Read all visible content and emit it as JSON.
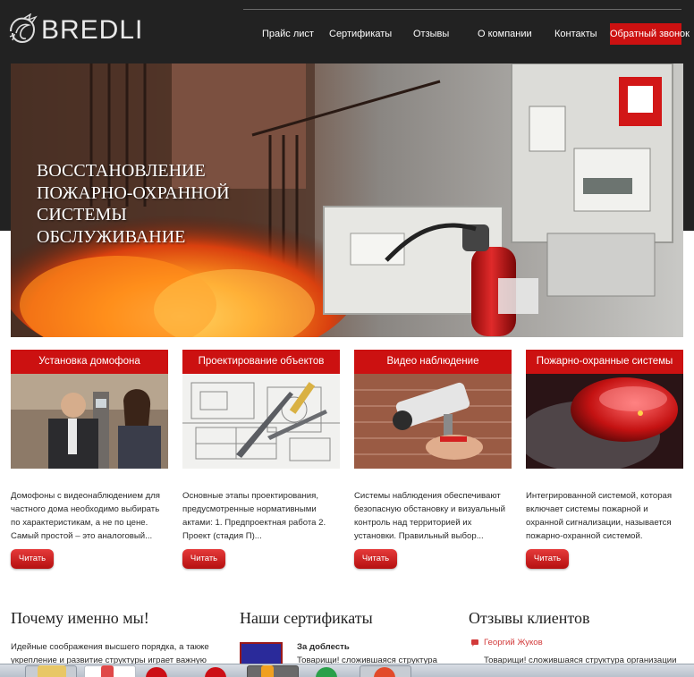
{
  "brand": {
    "name": "BREDLI",
    "text_color": "#e9e9e9",
    "accent": "#cc1111"
  },
  "nav": {
    "items": [
      {
        "label": "Прайс лист"
      },
      {
        "label": "Сертификаты"
      },
      {
        "label": "Отзывы"
      },
      {
        "label": "О компании"
      },
      {
        "label": "Контакты"
      }
    ],
    "cta": "Обратный звонок"
  },
  "hero": {
    "title_lines": [
      "Восстановление",
      "пожарно-охранной",
      "системы",
      "обслуживание"
    ],
    "image": "fire-and-alarm-equipment-photo"
  },
  "services": [
    {
      "title": "Установка домофона",
      "image": "intercom-photo",
      "text": "Домофоны с видеонаблюдением для частного дома необходимо выбирать по характеристикам, а не по цене. Самый простой – это аналоговый...",
      "button": "Читать"
    },
    {
      "title": "Проектирование объектов",
      "image": "blueprint-photo",
      "text": "Основные этапы проектирования, предусмотренные нормативными актами: 1. Предпроектная работа 2. Проект (стадия П)...",
      "button": "Читать"
    },
    {
      "title": "Видео наблюдение",
      "image": "cctv-camera-photo",
      "text": "Системы наблюдения обеспечивают безопасную обстановку и визуальный контроль над территорией их установки. Правильный выбор...",
      "button": "Читать"
    },
    {
      "title": "Пожарно-охранные системы",
      "image": "smoke-detector-photo",
      "text": "Интегрированной системой, которая включает системы пожарной и охранной сигнализации, называется пожарно-охранной системой.",
      "button": "Читать"
    }
  ],
  "why_us": {
    "title": "Почему именно мы!",
    "text_line1": "Идейные соображения высшего порядка, а также",
    "text_line2": "укрепление и развитие структуры играет важную"
  },
  "certificates": {
    "title": "Наши сертификаты",
    "item_title": "За доблесть",
    "item_text": "Товарищи! сложившаяся структура"
  },
  "reviews": {
    "title": "Отзывы клиентов",
    "author": "Георгий Жуков",
    "text": "Товарищи! сложившаяся структура организации"
  }
}
